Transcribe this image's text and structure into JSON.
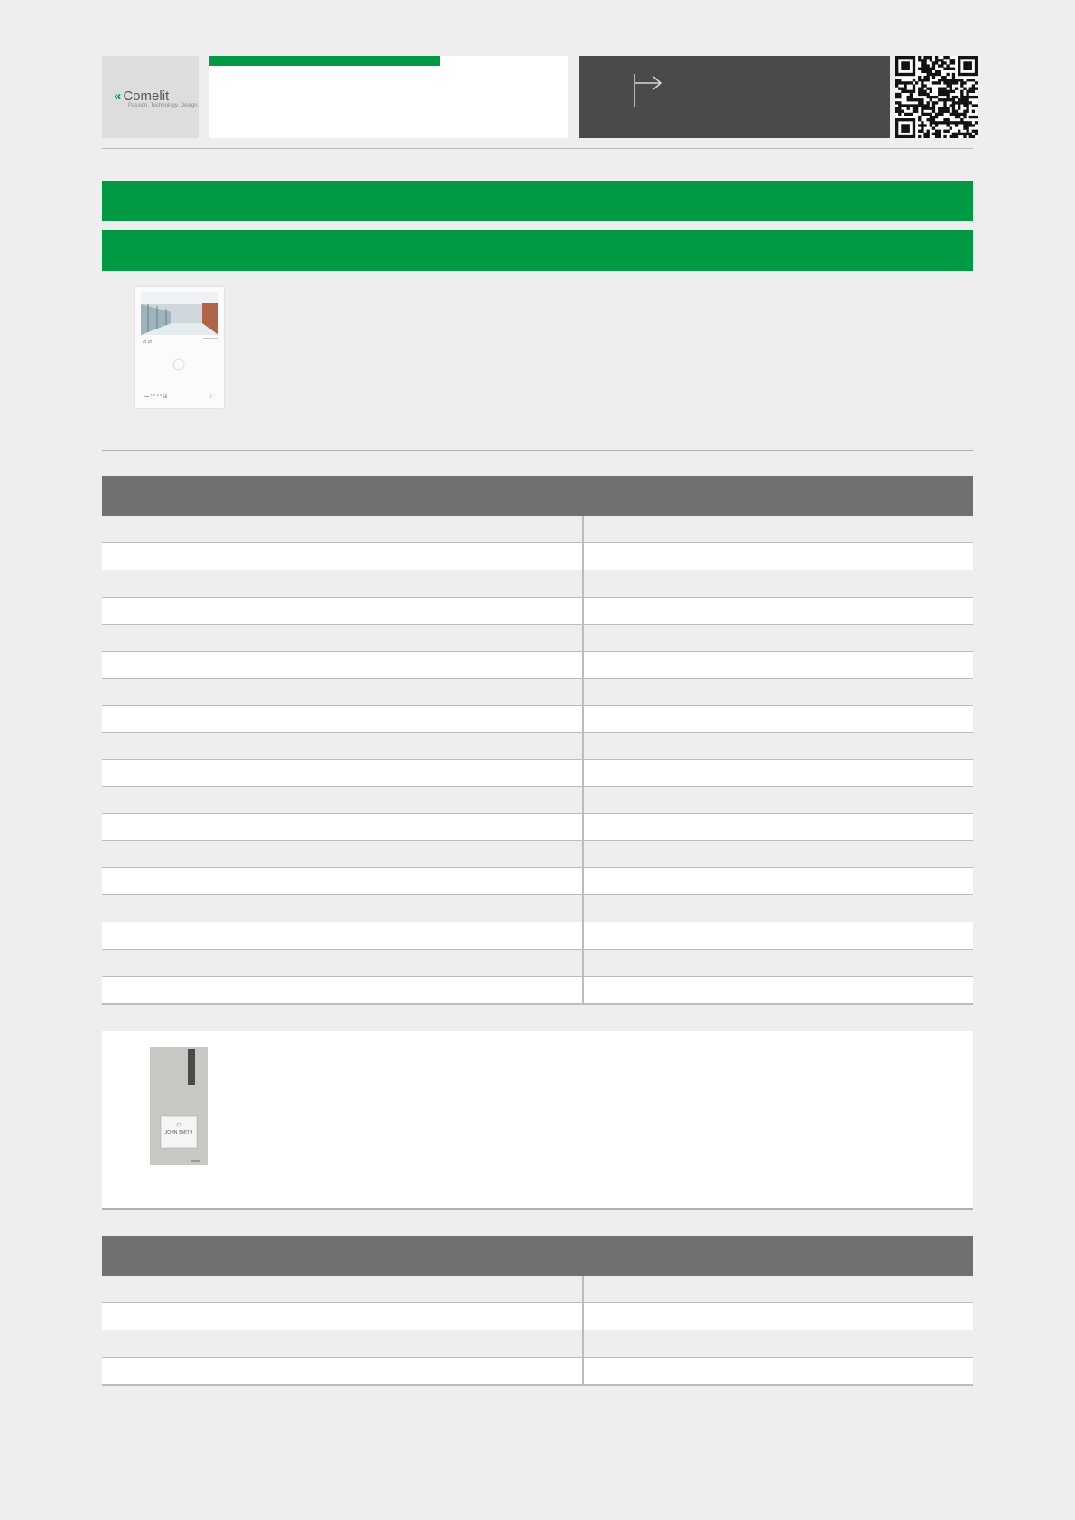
{
  "header": {
    "brand": "Comelit",
    "brand_tagline": "Passion. Technology. Design.",
    "colors": {
      "accent": "#009a44",
      "dark_panel": "#4a4a48",
      "table_header": "#707070",
      "background": "#eeeeee"
    },
    "icons": [
      "arrow-right-icon",
      "qr-code"
    ]
  },
  "monitor": {
    "screen_label": "SBC Comelit"
  },
  "entrance_panel": {
    "name_tag": "JOHN SMITH"
  },
  "spec_table": {
    "rows": [
      {
        "label": "",
        "value": ""
      },
      {
        "label": "",
        "value": ""
      },
      {
        "label": "",
        "value": ""
      },
      {
        "label": "",
        "value": ""
      },
      {
        "label": "",
        "value": ""
      },
      {
        "label": "",
        "value": ""
      },
      {
        "label": "",
        "value": ""
      },
      {
        "label": "",
        "value": ""
      },
      {
        "label": "",
        "value": ""
      },
      {
        "label": "",
        "value": ""
      },
      {
        "label": "",
        "value": ""
      },
      {
        "label": "",
        "value": ""
      },
      {
        "label": "",
        "value": ""
      },
      {
        "label": "",
        "value": ""
      },
      {
        "label": "",
        "value": ""
      },
      {
        "label": "",
        "value": ""
      },
      {
        "label": "",
        "value": ""
      },
      {
        "label": "",
        "value": ""
      }
    ]
  },
  "accessory_table": {
    "rows": [
      {
        "label": "",
        "value": ""
      },
      {
        "label": "",
        "value": ""
      },
      {
        "label": "",
        "value": ""
      },
      {
        "label": "",
        "value": ""
      }
    ]
  }
}
